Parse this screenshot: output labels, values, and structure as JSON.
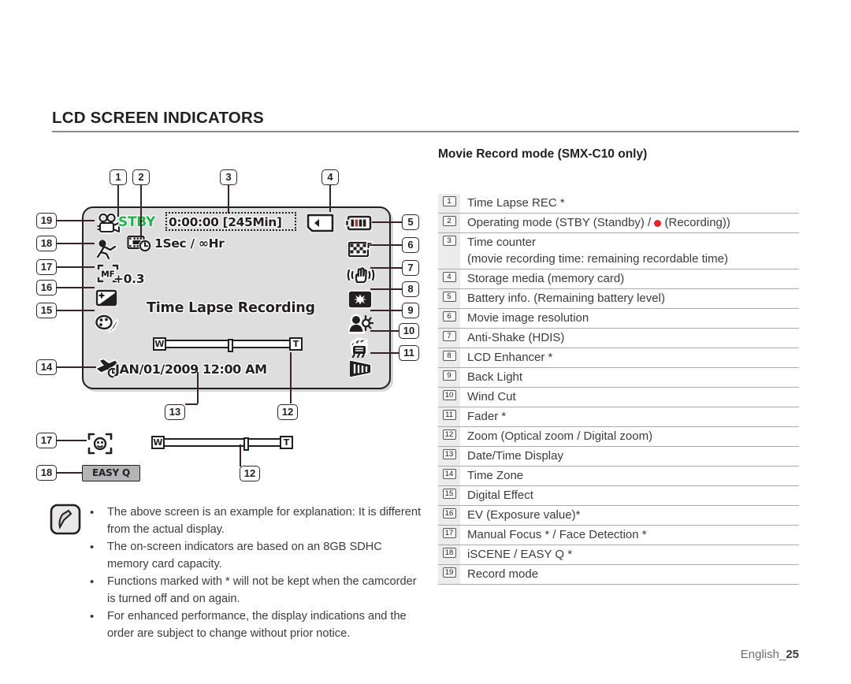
{
  "page": {
    "title": "LCD SCREEN INDICATORS",
    "footer_label": "English_",
    "footer_page": "25"
  },
  "section": {
    "heading": "Movie Record mode (SMX-C10 only)"
  },
  "indicators": [
    {
      "num": "1",
      "label": "Time Lapse REC *"
    },
    {
      "num": "2",
      "label_pre": "Operating mode (STBY (Standby) / ",
      "label_post": " (Recording))",
      "has_rec_dot": true
    },
    {
      "num": "3",
      "label": "Time counter",
      "label2": "(movie recording time: remaining recordable time)"
    },
    {
      "num": "4",
      "label": "Storage media (memory card)"
    },
    {
      "num": "5",
      "label": "Battery info. (Remaining battery level)"
    },
    {
      "num": "6",
      "label": "Movie image resolution"
    },
    {
      "num": "7",
      "label": "Anti-Shake (HDIS)"
    },
    {
      "num": "8",
      "label": "LCD Enhancer *"
    },
    {
      "num": "9",
      "label": "Back Light"
    },
    {
      "num": "10",
      "label": "Wind Cut"
    },
    {
      "num": "11",
      "label": "Fader *"
    },
    {
      "num": "12",
      "label": "Zoom (Optical zoom / Digital zoom)"
    },
    {
      "num": "13",
      "label": "Date/Time Display"
    },
    {
      "num": "14",
      "label": "Time Zone"
    },
    {
      "num": "15",
      "label": "Digital Effect"
    },
    {
      "num": "16",
      "label": "EV (Exposure value)*"
    },
    {
      "num": "17",
      "label": "Manual Focus * / Face Detection *"
    },
    {
      "num": "18",
      "label": "iSCENE / EASY Q *"
    },
    {
      "num": "19",
      "label": "Record mode"
    }
  ],
  "lcd": {
    "operating_mode": "STBY",
    "operating_mode_color": "#23b14c",
    "time_counter": "0:00:00 [245Min]",
    "time_lapse_interval": "1Sec / ∞Hr",
    "ev_value": "+0.3",
    "mode_text": "Time Lapse Recording",
    "datetime": "JAN/01/2009 12:00 AM",
    "zoom_wide_label": "W",
    "zoom_tele_label": "T",
    "icons": {
      "record_mode": "movie-camera-icon",
      "time_zone": "airplane-clock-icon",
      "manual_focus": "manual-focus-icon",
      "ev": "exposure-value-icon",
      "digital_effect": "digital-effect-icon",
      "time_lapse": "time-lapse-icon",
      "storage_media": "memory-card-icon",
      "battery": "battery-icon",
      "resolution": "movie-resolution-icon",
      "anti_shake": "anti-shake-icon",
      "lcd_enhancer": "lcd-enhancer-icon",
      "back_light": "back-light-icon",
      "wind_cut": "wind-cut-icon",
      "fader": "fader-icon"
    }
  },
  "secondary": {
    "face_detection_num": "17",
    "easyq_num": "18",
    "easyq_label": "EASY Q",
    "zoom_num": "12",
    "datetime_num": "13",
    "zoom_wide_label": "W",
    "zoom_tele_label": "T"
  },
  "callouts": {
    "top": [
      "1",
      "2",
      "3",
      "4"
    ],
    "left": [
      "19",
      "18",
      "17",
      "16",
      "15",
      "14"
    ],
    "right": [
      "5",
      "6",
      "7",
      "8",
      "9",
      "10",
      "11"
    ],
    "bottom": [
      "13",
      "12"
    ]
  },
  "notes": [
    "The above screen is an example for explanation: It is different from the actual display.",
    "The on-screen indicators are based on an 8GB SDHC memory card capacity.",
    "Functions marked with * will not be kept when the camcorder is turned off and on again.",
    "For enhanced performance, the display indications and the order are subject to change without prior notice."
  ],
  "note_bullet": "•"
}
